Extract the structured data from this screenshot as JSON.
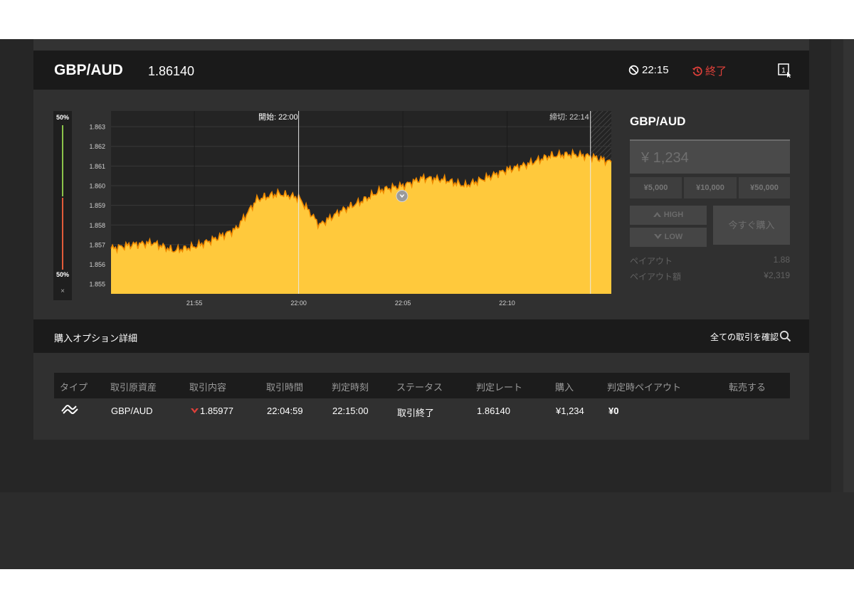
{
  "header": {
    "pair": "GBP/AUD",
    "rate": "1.86140",
    "time": "22:15",
    "status": "終了"
  },
  "sentiment": {
    "high_pct": "50%",
    "low_pct": "50%",
    "close": "×"
  },
  "chart_data": {
    "type": "area",
    "y_ticks": [
      "1.863",
      "1.862",
      "1.861",
      "1.860",
      "1.859",
      "1.858",
      "1.857",
      "1.856",
      "1.855"
    ],
    "x_ticks": [
      "21:55",
      "22:00",
      "22:05",
      "22:10"
    ],
    "start_label": "開始: 22:00",
    "deadline_label": "締切: 22:14",
    "ylim": [
      1.8545,
      1.8638
    ],
    "x": [
      "21:51",
      "21:52",
      "21:53",
      "21:54",
      "21:55",
      "21:56",
      "21:57",
      "21:58",
      "21:59",
      "22:00",
      "22:01",
      "22:02",
      "22:03",
      "22:04",
      "22:05",
      "22:06",
      "22:07",
      "22:08",
      "22:09",
      "22:10",
      "22:11",
      "22:12",
      "22:13",
      "22:14",
      "22:15"
    ],
    "values": [
      1.8568,
      1.857,
      1.8571,
      1.8567,
      1.8569,
      1.8573,
      1.8578,
      1.8593,
      1.8596,
      1.8594,
      1.858,
      1.8587,
      1.8592,
      1.8598,
      1.86,
      1.8604,
      1.8603,
      1.86,
      1.8604,
      1.8608,
      1.8611,
      1.8615,
      1.8616,
      1.8615,
      1.8612
    ],
    "entry": {
      "x": "22:04",
      "value": 1.8598
    },
    "grid": true,
    "colors": {
      "area_fill": "#ffc93c",
      "area_stroke": "#f08a00",
      "plot_bg": "#242424",
      "grid": "#383838"
    }
  },
  "side": {
    "title": "GBP/AUD",
    "amount": "¥ 1,234",
    "quick": [
      "¥5,000",
      "¥10,000",
      "¥50,000"
    ],
    "high": "HIGH",
    "low": "LOW",
    "buy_now": "今すぐ購入",
    "payout_label": "ペイアウト",
    "payout_value": "1.88",
    "payout_amount_label": "ペイアウト額",
    "payout_amount_value": "¥2,319"
  },
  "details": {
    "title": "購入オプション詳細",
    "link": "全ての取引を確認"
  },
  "table": {
    "headers": [
      "タイプ",
      "取引原資産",
      "取引内容",
      "取引時間",
      "判定時刻",
      "ステータス",
      "判定レート",
      "購入",
      "判定時ペイアウト",
      "転売する"
    ],
    "row": {
      "asset": "GBP/AUD",
      "direction": "1.85977",
      "trade_time": "22:04:59",
      "judge_time": "22:15:00",
      "status": "取引終了",
      "judge_rate": "1.86140",
      "purchase": "¥1,234",
      "payout": "¥0"
    }
  }
}
